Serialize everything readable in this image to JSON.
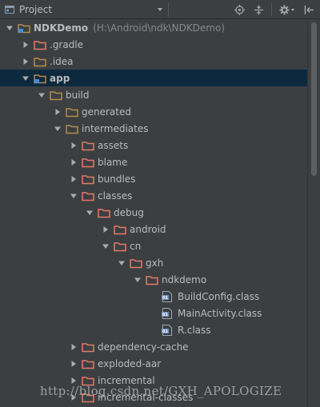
{
  "toolbar": {
    "view_label": "Project",
    "view_icon": "project-view-icon",
    "buttons": [
      "locate-target-icon",
      "collapse-all-icon",
      "settings-gear-icon",
      "hide-panel-icon"
    ]
  },
  "colors": {
    "background": "#3c3f41",
    "selection": "#0d293e",
    "text": "#bbbbbb",
    "path_text": "#888888",
    "folder": "#b38b4f",
    "folder_excluded": "#e07b6a",
    "module_marker": "#4a8ad4",
    "class_file": "#6e8fbd"
  },
  "tree": [
    {
      "label": "NDKDemo",
      "path": "(H:\\Android\\ndk\\NDKDemo)",
      "depth": 0,
      "expanded": true,
      "kind": "project",
      "bold": true
    },
    {
      "label": ".gradle",
      "depth": 1,
      "expanded": false,
      "kind": "folder-excluded"
    },
    {
      "label": ".idea",
      "depth": 1,
      "expanded": false,
      "kind": "folder"
    },
    {
      "label": "app",
      "depth": 1,
      "expanded": true,
      "kind": "module",
      "bold": true,
      "selected": true
    },
    {
      "label": "build",
      "depth": 2,
      "expanded": true,
      "kind": "folder"
    },
    {
      "label": "generated",
      "depth": 3,
      "expanded": false,
      "kind": "folder"
    },
    {
      "label": "intermediates",
      "depth": 3,
      "expanded": true,
      "kind": "folder"
    },
    {
      "label": "assets",
      "depth": 4,
      "expanded": false,
      "kind": "folder-excluded"
    },
    {
      "label": "blame",
      "depth": 4,
      "expanded": false,
      "kind": "folder-excluded"
    },
    {
      "label": "bundles",
      "depth": 4,
      "expanded": false,
      "kind": "folder-excluded"
    },
    {
      "label": "classes",
      "depth": 4,
      "expanded": true,
      "kind": "folder-excluded"
    },
    {
      "label": "debug",
      "depth": 5,
      "expanded": true,
      "kind": "folder-excluded"
    },
    {
      "label": "android",
      "depth": 6,
      "expanded": false,
      "kind": "folder-excluded"
    },
    {
      "label": "cn",
      "depth": 6,
      "expanded": true,
      "kind": "folder-excluded"
    },
    {
      "label": "gxh",
      "depth": 7,
      "expanded": true,
      "kind": "folder-excluded"
    },
    {
      "label": "ndkdemo",
      "depth": 8,
      "expanded": true,
      "kind": "folder-excluded"
    },
    {
      "label": "BuildConfig.class",
      "depth": 9,
      "kind": "class"
    },
    {
      "label": "MainActivity.class",
      "depth": 9,
      "kind": "class"
    },
    {
      "label": "R.class",
      "depth": 9,
      "kind": "class"
    },
    {
      "label": "dependency-cache",
      "depth": 4,
      "expanded": false,
      "kind": "folder-excluded"
    },
    {
      "label": "exploded-aar",
      "depth": 4,
      "expanded": false,
      "kind": "folder-excluded"
    },
    {
      "label": "incremental",
      "depth": 4,
      "expanded": false,
      "kind": "folder-excluded"
    },
    {
      "label": "incremental-classes",
      "depth": 4,
      "expanded": false,
      "kind": "folder-excluded"
    }
  ],
  "watermark": "http://blog.csdn.net/GXH_APOLOGIZE"
}
